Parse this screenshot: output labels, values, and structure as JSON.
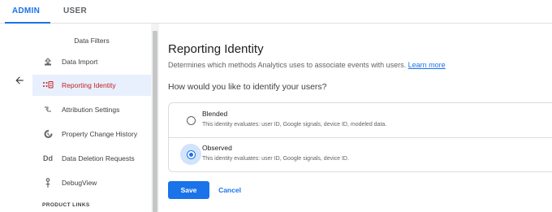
{
  "tabs": [
    {
      "label": "ADMIN",
      "active": true
    },
    {
      "label": "USER",
      "active": false
    }
  ],
  "sidebar": {
    "section_title": "Data Filters",
    "items": [
      {
        "label": "Data Import",
        "icon": "upload-icon",
        "active": false
      },
      {
        "label": "Reporting Identity",
        "icon": "reporting-identity-icon",
        "active": true
      },
      {
        "label": "Attribution Settings",
        "icon": "attribution-icon",
        "active": false
      },
      {
        "label": "Property Change History",
        "icon": "history-icon",
        "active": false
      },
      {
        "label": "Data Deletion Requests",
        "icon": "dd-icon",
        "icon_text": "Dd",
        "active": false
      },
      {
        "label": "DebugView",
        "icon": "debug-icon",
        "active": false
      }
    ],
    "group_label": "PRODUCT LINKS"
  },
  "main": {
    "title": "Reporting Identity",
    "description": "Determines which methods Analytics uses to associate events with users.",
    "learn_more": "Learn more",
    "question": "How would you like to identify your users?",
    "options": [
      {
        "title": "Blended",
        "description": "This identity evaluates: user ID, Google signals, device ID, modeled data.",
        "selected": false
      },
      {
        "title": "Observed",
        "description": "This identity evaluates: user ID, Google signals, device ID.",
        "selected": true
      }
    ],
    "save_label": "Save",
    "cancel_label": "Cancel"
  },
  "colors": {
    "accent": "#1a73e8",
    "active_nav_text": "#c5221f",
    "active_nav_bg": "#e8f0fe"
  }
}
